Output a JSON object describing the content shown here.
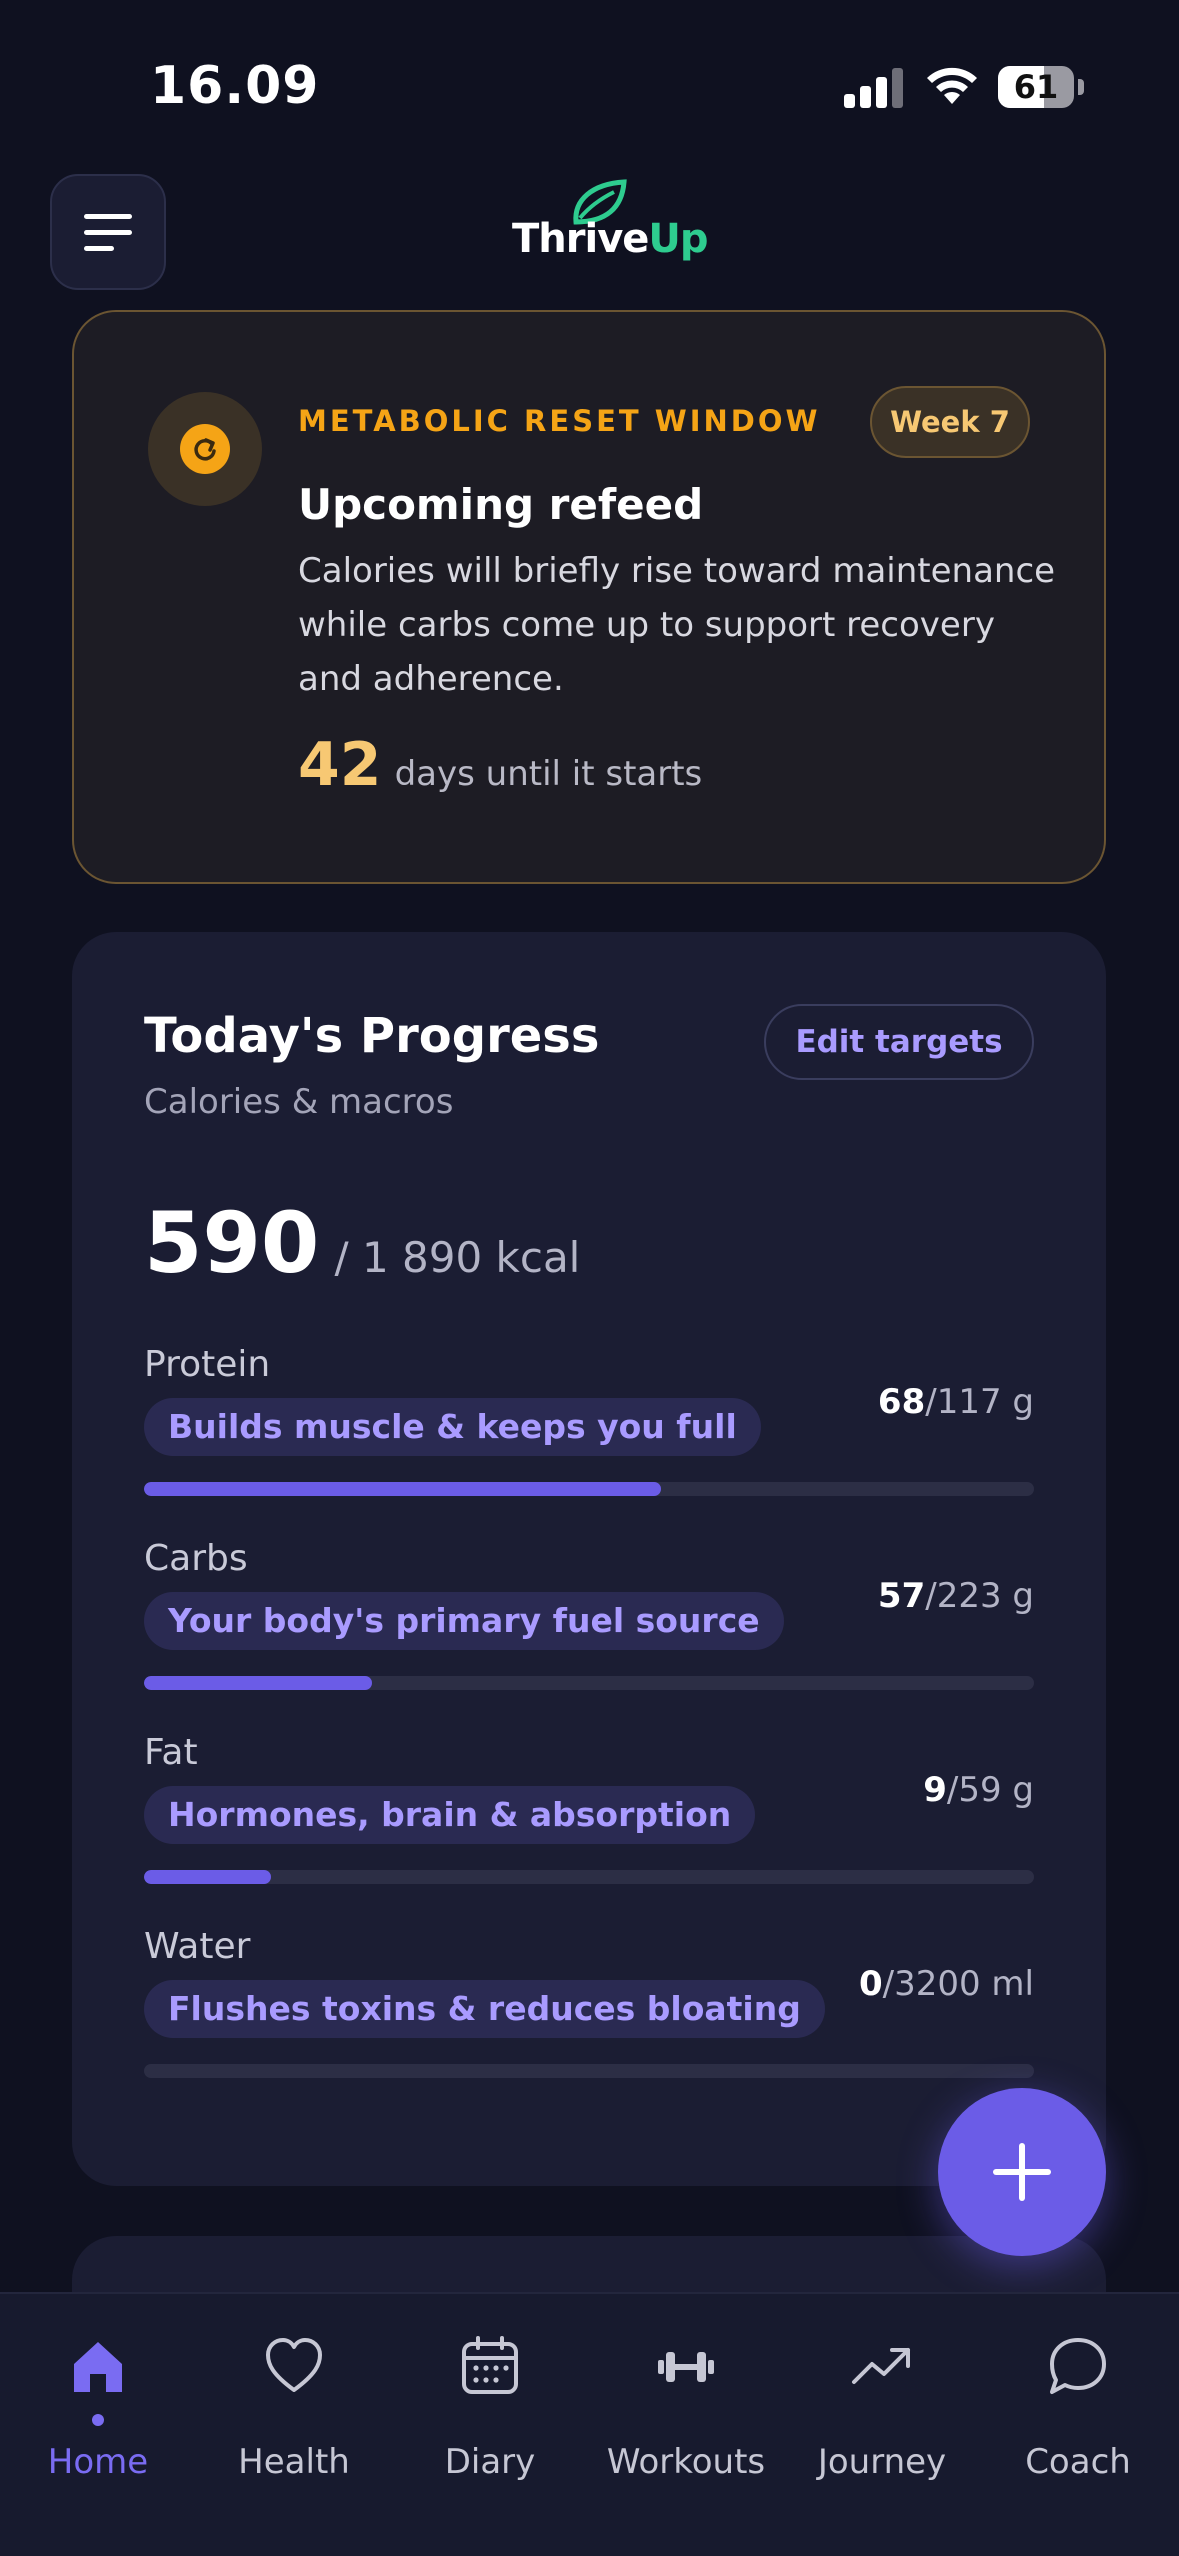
{
  "status_bar": {
    "time": "16.09",
    "battery": "61",
    "battery_level": 0.61
  },
  "header": {
    "logo_primary": "Thrive",
    "logo_accent": "Up",
    "menu_icon": "hamburger-icon"
  },
  "refeed": {
    "eyebrow": "METABOLIC RESET WINDOW",
    "week_badge": "Week 7",
    "title": "Upcoming refeed",
    "description": "Calories will briefly rise toward maintenance while carbs come up to support recovery and adherence.",
    "days_count": "42",
    "days_label": "days until it starts",
    "icon": "refresh-icon"
  },
  "progress": {
    "title": "Today's Progress",
    "subtitle": "Calories & macros",
    "edit_label": "Edit targets",
    "kcal_value": "590",
    "kcal_target": "/ 1 890 kcal",
    "macros": [
      {
        "name": "Protein",
        "chip": "Builds muscle & keeps you full",
        "current": "68",
        "target": "/117 g",
        "fraction": 0.581
      },
      {
        "name": "Carbs",
        "chip": "Your body's primary fuel source",
        "current": "57",
        "target": "/223 g",
        "fraction": 0.256
      },
      {
        "name": "Fat",
        "chip": "Hormones, brain & absorption",
        "current": "9",
        "target": "/59 g",
        "fraction": 0.143
      },
      {
        "name": "Water",
        "chip": "Flushes toxins & reduces bloating",
        "current": "0",
        "target": "/3200 ml",
        "fraction": 0
      }
    ]
  },
  "fab": {
    "icon": "plus-icon"
  },
  "nav": [
    {
      "label": "Home",
      "icon": "home-icon",
      "active": true
    },
    {
      "label": "Health",
      "icon": "heart-icon",
      "active": false
    },
    {
      "label": "Diary",
      "icon": "calendar-icon",
      "active": false
    },
    {
      "label": "Workouts",
      "icon": "dumbbell-icon",
      "active": false
    },
    {
      "label": "Journey",
      "icon": "trending-up-icon",
      "active": false
    },
    {
      "label": "Coach",
      "icon": "chat-bubble-icon",
      "active": false
    }
  ],
  "colors": {
    "accent": "#6b5ce7",
    "accent_text": "#a99bff",
    "warning": "#f5a416",
    "brand_green": "#2ecc8f",
    "background": "#0f1120",
    "card": "#1b1d33"
  }
}
